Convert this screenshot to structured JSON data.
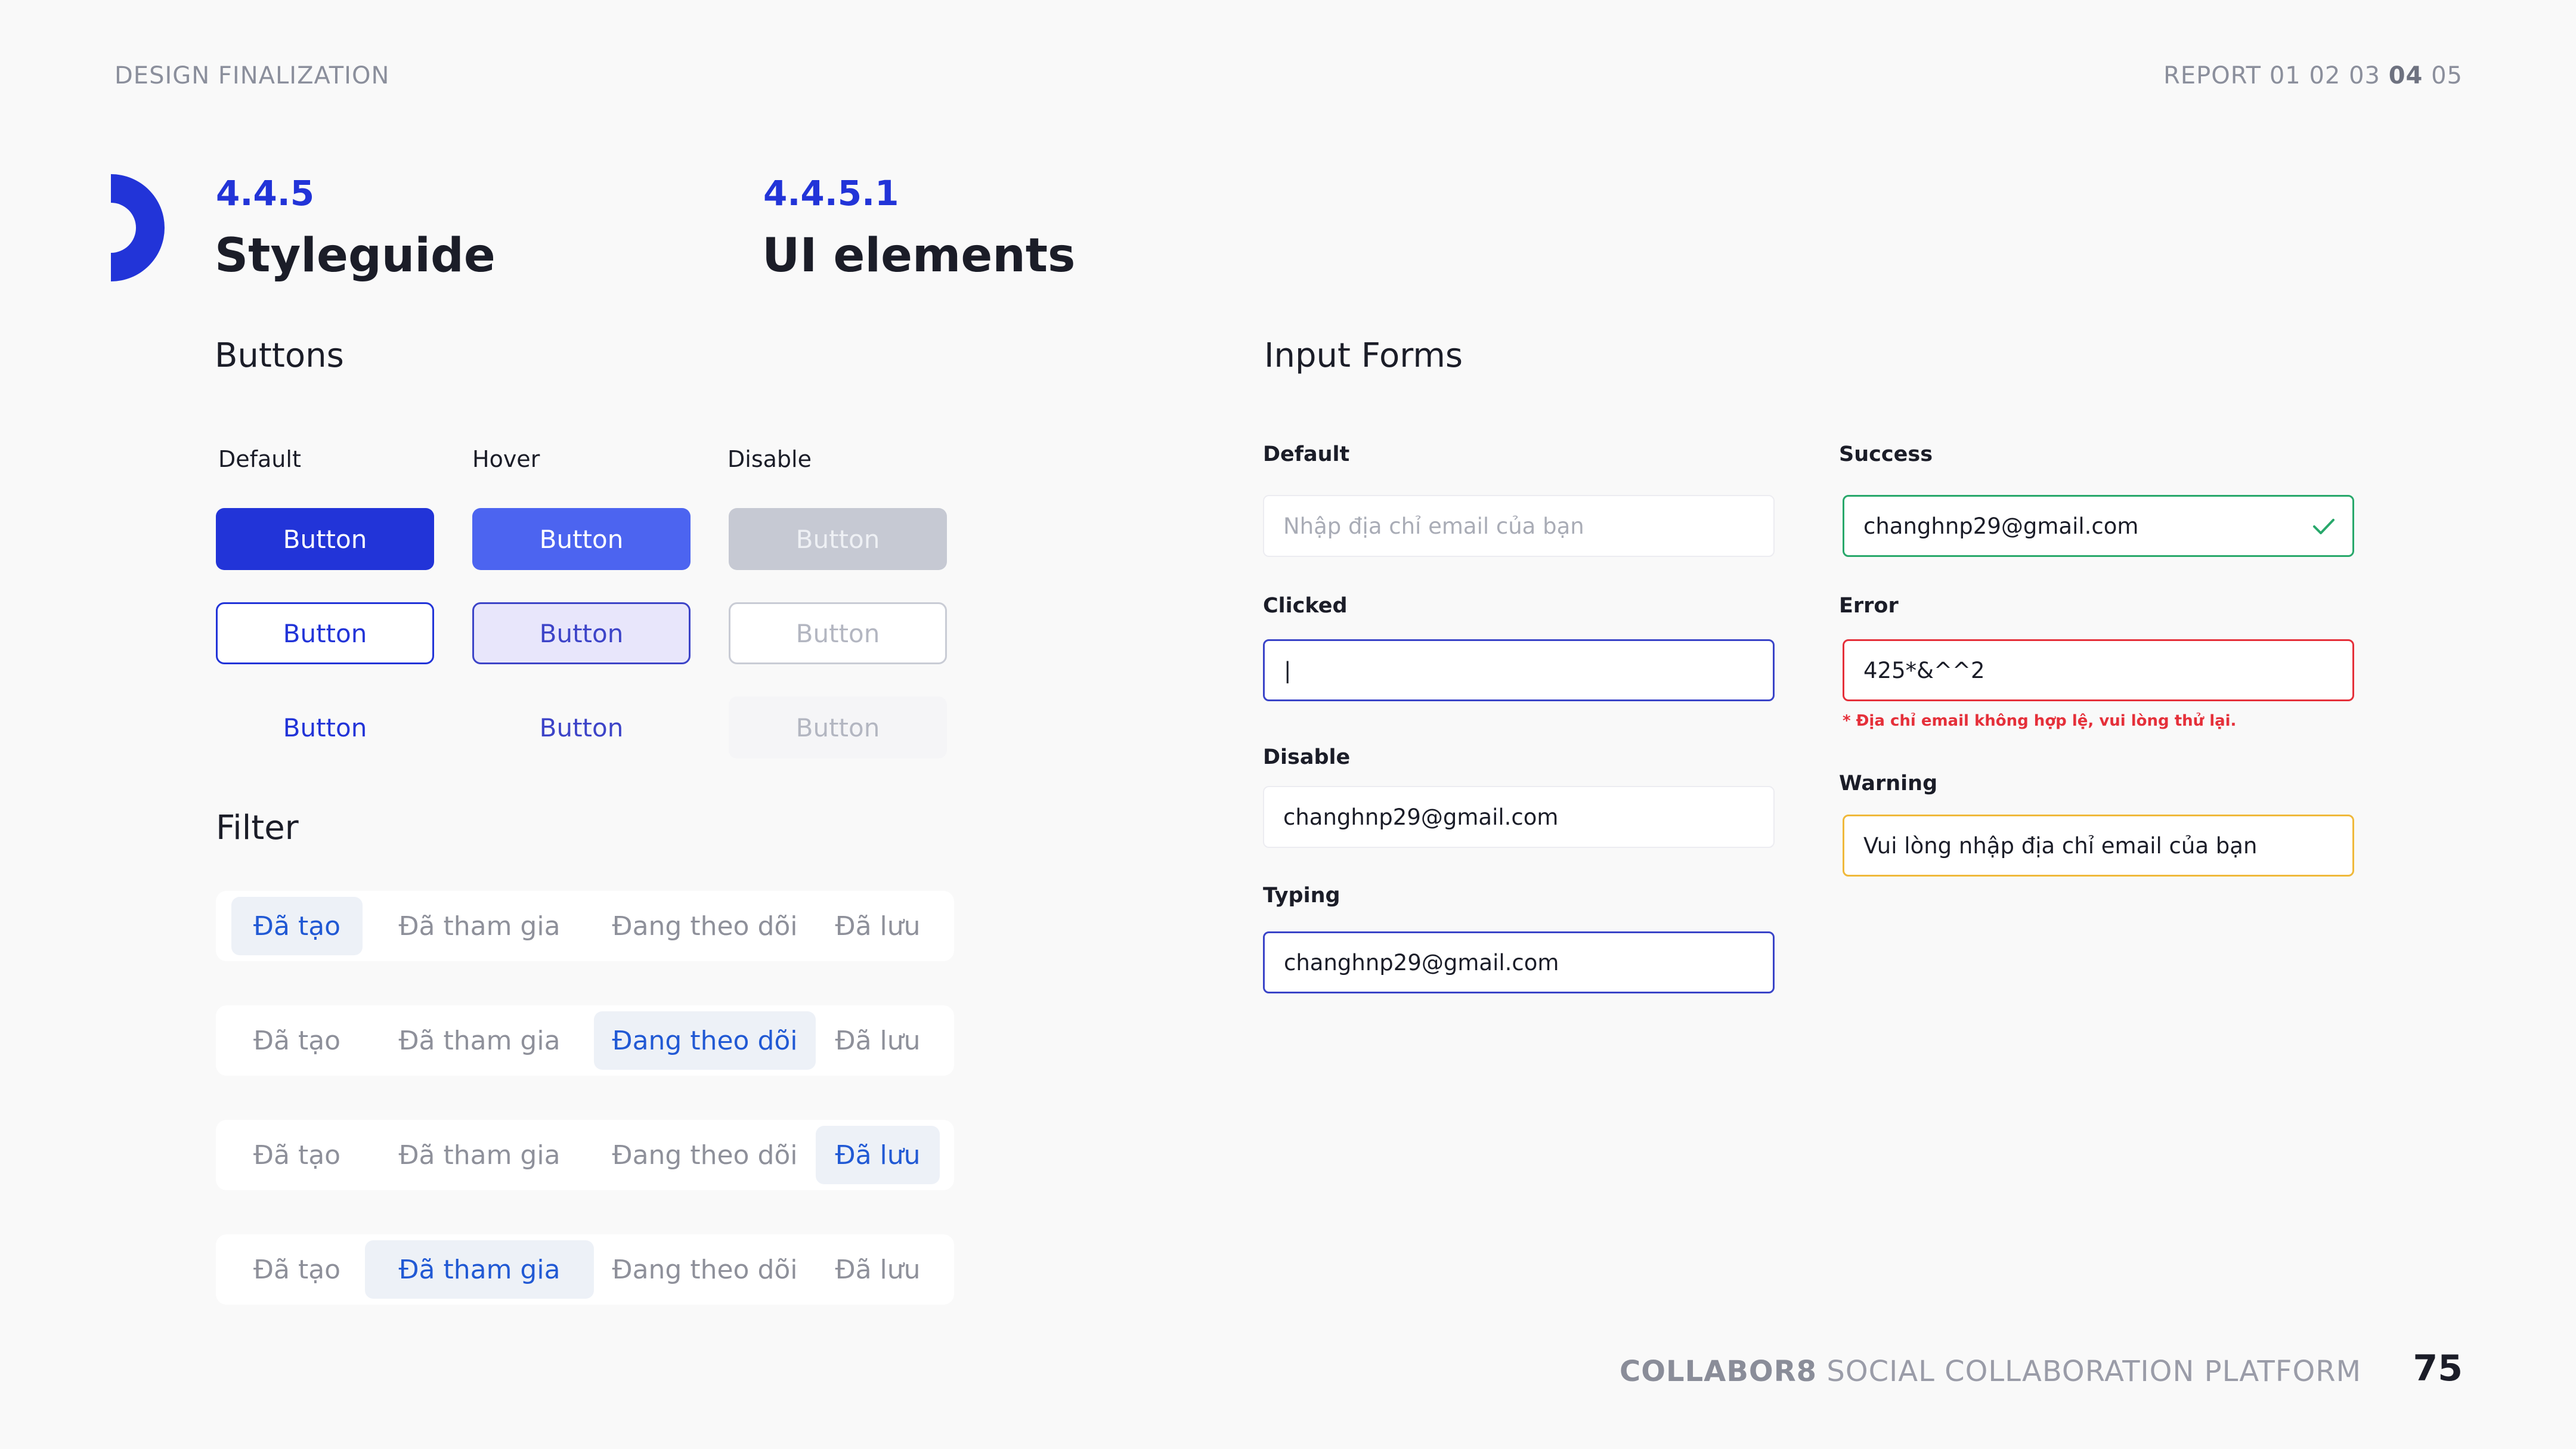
{
  "header": {
    "left": "DESIGN FINALIZATION",
    "report_label": "REPORT",
    "report_pages": [
      "01",
      "02",
      "03",
      "04",
      "05"
    ],
    "current_page": "04"
  },
  "section": {
    "num1": "4.4.5",
    "title1": "Styleguide",
    "num2": "4.4.5.1",
    "title2": "UI elements"
  },
  "buttons": {
    "heading": "Buttons",
    "states": [
      "Default",
      "Hover",
      "Disable"
    ],
    "label": "Button"
  },
  "filter": {
    "heading": "Filter",
    "tabs": [
      "Đã tạo",
      "Đã tham gia",
      "Đang theo dõi",
      "Đã lưu"
    ],
    "active_per_row": [
      0,
      2,
      3,
      1
    ]
  },
  "inputs": {
    "heading": "Input Forms",
    "default_label": "Default",
    "default_placeholder": "Nhập địa chỉ email của bạn",
    "clicked_label": "Clicked",
    "clicked_value": "|",
    "disable_label": "Disable",
    "disable_value": "changhnp29@gmail.com",
    "typing_label": "Typing",
    "typing_value": "changhnp29@gmail.com",
    "success_label": "Success",
    "success_value": "changhnp29@gmail.com",
    "error_label": "Error",
    "error_value": "425*&^^2",
    "error_message": "* Địa chỉ email không hợp lệ, vui lòng thử lại.",
    "warning_label": "Warning",
    "warning_value": "Vui lòng nhập địa chỉ email của bạn"
  },
  "footer": {
    "brand": "COLLABOR8",
    "tagline": "SOCIAL COLLABORATION PLATFORM",
    "page_number": "75"
  },
  "colors": {
    "primary": "#2234d8",
    "hover": "#4c64f0",
    "disabled": "#c6c9d3",
    "success": "#28a86b",
    "error": "#e5303a",
    "warning": "#f0b93b"
  }
}
